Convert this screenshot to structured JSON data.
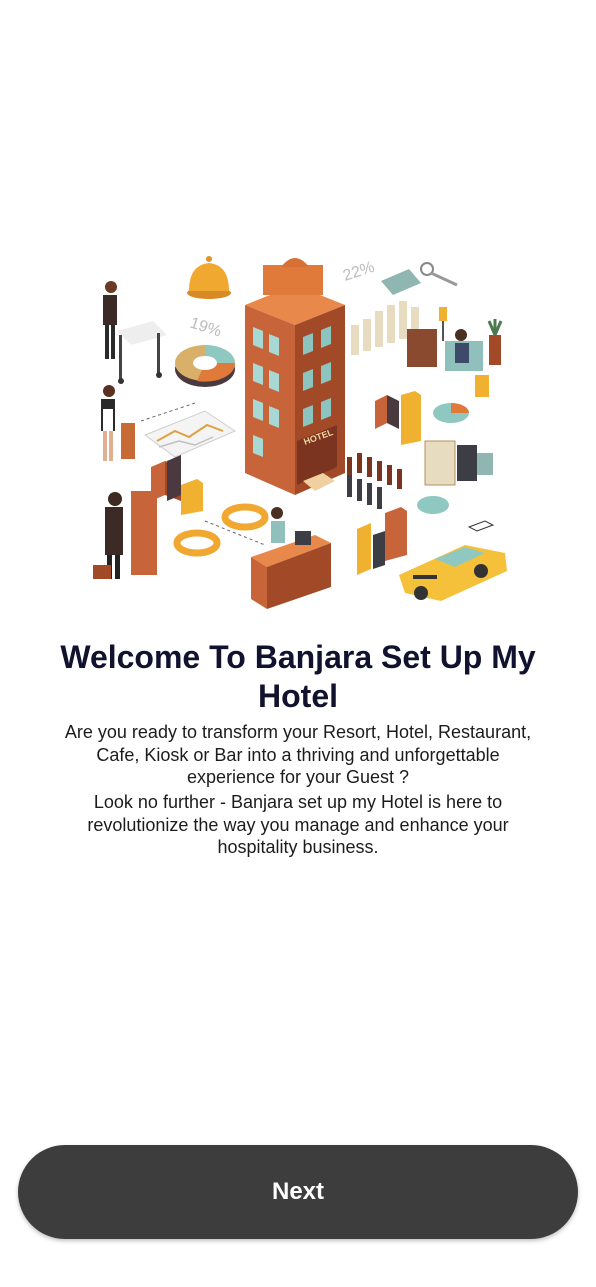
{
  "welcome": {
    "title": "Welcome To Banjara Set Up My Hotel",
    "paragraph_1": "Are you ready to transform your Resort, Hotel, Restaurant, Cafe, Kiosk or Bar into a thriving and unforgettable experience for your Guest ?",
    "paragraph_2": "Look no further - Banjara set up my Hotel is here to revolutionize the way you manage and enhance your hospitality business."
  },
  "illustration": {
    "name": "hotel-isometric-illustration",
    "labels": {
      "percent_left": "19%",
      "percent_right": "22%",
      "hotel_sign": "HOTEL"
    }
  },
  "footer": {
    "next_label": "Next"
  },
  "colors": {
    "title": "#10122e",
    "button_bg": "#3d3d3d",
    "button_text": "#ffffff",
    "hotel_orange": "#c8643a",
    "accent_yellow": "#f0b030",
    "accent_teal": "#8fc8c0"
  }
}
